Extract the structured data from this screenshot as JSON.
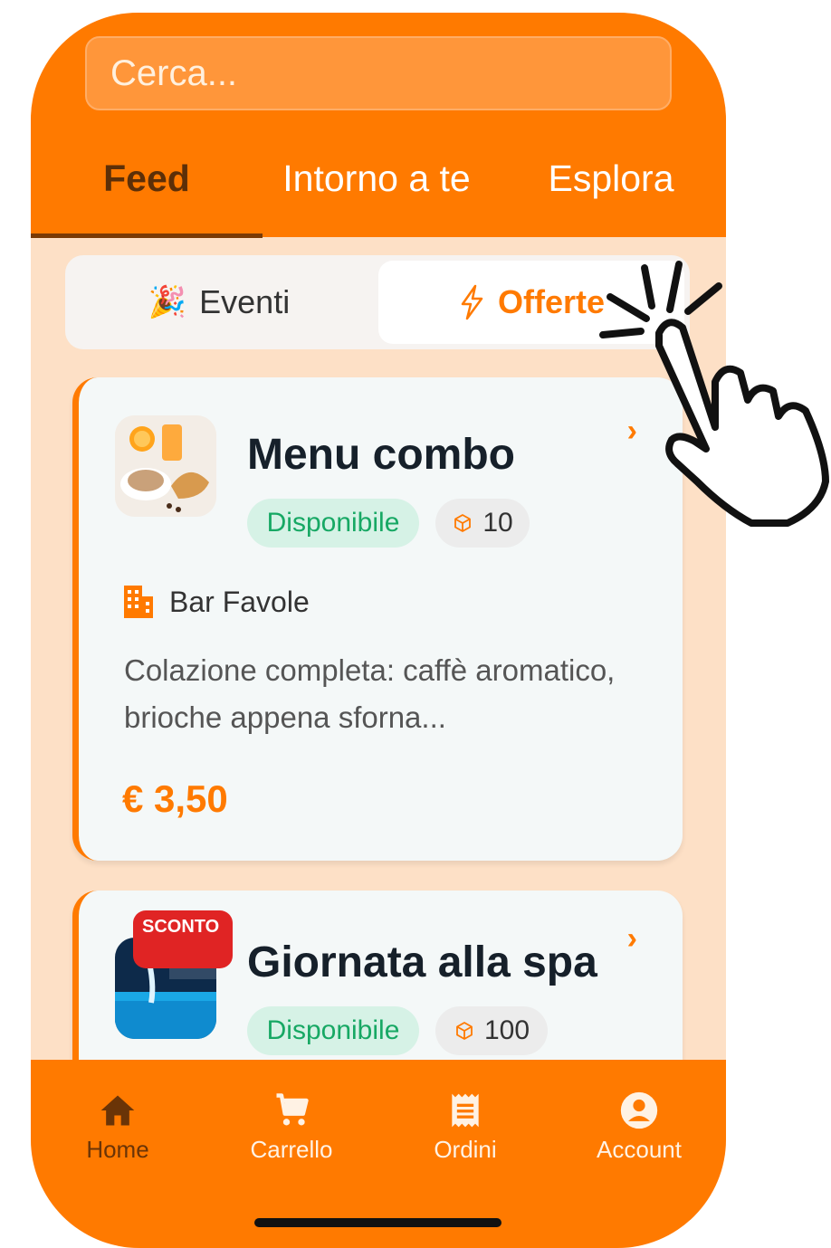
{
  "search": {
    "placeholder": "Cerca..."
  },
  "tabs": [
    {
      "label": "Feed",
      "active": true
    },
    {
      "label": "Intorno a te",
      "active": false
    },
    {
      "label": "Esplora",
      "active": false
    }
  ],
  "segments": [
    {
      "label": "Eventi",
      "icon": "party-popper-icon",
      "selected": false
    },
    {
      "label": "Offerte",
      "icon": "lightning-icon",
      "selected": true
    }
  ],
  "cards": [
    {
      "title": "Menu combo",
      "status": "Disponibile",
      "stock": "10",
      "venue": "Bar Favole",
      "description": "Colazione completa: caffè aromatico, brioche appena sforna...",
      "price": "€ 3,50",
      "image": "breakfast-thumbnail"
    },
    {
      "title": "Giornata alla spa",
      "badge": "SCONTO",
      "status": "Disponibile",
      "stock": "100",
      "image": "spa-pool-thumbnail"
    }
  ],
  "bottom_nav": [
    {
      "label": "Home",
      "icon": "home-icon",
      "active": true
    },
    {
      "label": "Carrello",
      "icon": "cart-icon",
      "active": false
    },
    {
      "label": "Ordini",
      "icon": "receipt-icon",
      "active": false
    },
    {
      "label": "Account",
      "icon": "account-icon",
      "active": false
    }
  ],
  "colors": {
    "accent": "#ff7a00",
    "background": "#fde0c6",
    "available": "#17a864",
    "badge": "#e02424"
  }
}
